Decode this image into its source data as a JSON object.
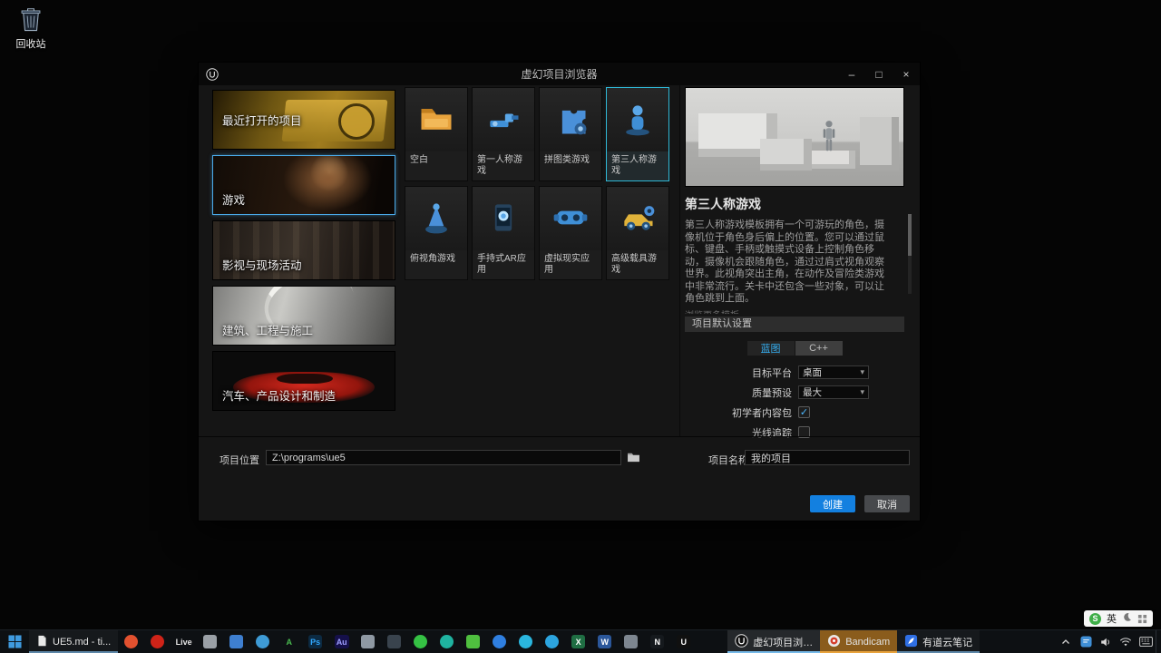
{
  "colors": {
    "accent_blue": "#35aef0",
    "selected_template_border": "#2fb8d6",
    "selected_category_border": "#4aa9e8",
    "create_button": "#1380e0",
    "bandicam_highlight": "#8a5c1c"
  },
  "desktop": {
    "recycle_bin_label": "回收站"
  },
  "window": {
    "title": "虚幻项目浏览器",
    "controls": {
      "minimize": "–",
      "maximize": "□",
      "close": "×"
    },
    "categories": [
      {
        "label": "最近打开的项目",
        "image": "recent-projects-thumb",
        "selected": false
      },
      {
        "label": "游戏",
        "image": "games-thumb",
        "selected": true
      },
      {
        "label": "影视与现场活动",
        "image": "film-live-events-thumb",
        "selected": false
      },
      {
        "label": "建筑、工程与施工",
        "image": "architecture-thumb",
        "selected": false
      },
      {
        "label": "汽车、产品设计和制造",
        "image": "automotive-thumb",
        "selected": false
      }
    ],
    "templates": [
      {
        "label": "空白",
        "icon": "blank-folder-icon",
        "selected": false
      },
      {
        "label": "第一人称游戏",
        "icon": "first-person-icon",
        "selected": false
      },
      {
        "label": "拼图类游戏",
        "icon": "puzzle-icon",
        "selected": false
      },
      {
        "label": "第三人称游戏",
        "icon": "third-person-icon",
        "selected": true
      },
      {
        "label": "俯视角游戏",
        "icon": "top-down-icon",
        "selected": false
      },
      {
        "label": "手持式AR应用",
        "icon": "handheld-ar-icon",
        "selected": false
      },
      {
        "label": "虚拟现实应用",
        "icon": "virtual-reality-icon",
        "selected": false
      },
      {
        "label": "高级载具游戏",
        "icon": "vehicle-icon",
        "selected": false
      }
    ],
    "detail": {
      "title": "第三人称游戏",
      "description": "第三人称游戏模板拥有一个可游玩的角色，摄像机位于角色身后偏上的位置。您可以通过鼠标、键盘、手柄或触摸式设备上控制角色移动，摄像机会跟随角色，通过过肩式视角观察世界。此视角突出主角，在动作及冒险类游戏中非常流行。关卡中还包含一些对象，可以让角色跳到上面。",
      "clipped_line": "浏览更多模板",
      "settings_header": "项目默认设置",
      "implementation": {
        "blueprint": "蓝图",
        "cpp": "C++"
      },
      "rows": {
        "target_platform_label": "目标平台",
        "target_platform_value": "桌面",
        "quality_label": "质量预设",
        "quality_value": "最大",
        "starter_content_label": "初学者内容包",
        "raytracing_label": "光线追踪"
      },
      "checkbox_checked_glyph": "✓",
      "dropdown_arrow": "▾"
    },
    "footer": {
      "location_label": "项目位置",
      "location_value": "Z:\\programs\\ue5",
      "name_label": "项目名称",
      "name_value": "我的项目",
      "create_label": "创建",
      "cancel_label": "取消"
    }
  },
  "taskbar": {
    "left_task_label": "UE5.md - ti...",
    "pinned": [
      {
        "name": "browser-icon",
        "shape": "circle",
        "bg": "#e2512f"
      },
      {
        "name": "red-circle-app-icon",
        "shape": "circle",
        "bg": "#cf2318"
      },
      {
        "name": "live-app-icon",
        "shape": "label",
        "bg": "transparent",
        "fg": "#e6e6e6",
        "glyph": "Live"
      },
      {
        "name": "camera-app-icon",
        "shape": "square",
        "bg": "#9aa0a6"
      },
      {
        "name": "blue-square-app-icon",
        "shape": "square",
        "bg": "#3e7fd0"
      },
      {
        "name": "blue-circle-app-icon",
        "shape": "circle",
        "bg": "#3e9bd6"
      },
      {
        "name": "green-a-app-icon",
        "shape": "label",
        "bg": "transparent",
        "fg": "#49b84f",
        "glyph": "A"
      },
      {
        "name": "photoshop-icon",
        "shape": "label",
        "bg": "#0c2a42",
        "fg": "#31a8ff",
        "glyph": "Ps"
      },
      {
        "name": "audition-icon",
        "shape": "label",
        "bg": "#15104a",
        "fg": "#9e9eff",
        "glyph": "Au"
      },
      {
        "name": "photos-app-icon",
        "shape": "square",
        "bg": "#8f99a3"
      },
      {
        "name": "dark-tool-app-icon",
        "shape": "square",
        "bg": "#39434d"
      },
      {
        "name": "wechat-icon",
        "shape": "circle",
        "bg": "#35c244"
      },
      {
        "name": "teal-circle-app-icon",
        "shape": "circle",
        "bg": "#1fb3a0"
      },
      {
        "name": "green-square-app-icon",
        "shape": "square",
        "bg": "#4fbf3f"
      },
      {
        "name": "blue-round-app-icon",
        "shape": "circle",
        "bg": "#2f7fe0"
      },
      {
        "name": "cyan-circle-app-icon",
        "shape": "circle",
        "bg": "#2ab6de"
      },
      {
        "name": "telegram-icon",
        "shape": "circle",
        "bg": "#2ca5e0"
      },
      {
        "name": "excel-icon",
        "shape": "label",
        "bg": "#1f6e43",
        "fg": "#ffffff",
        "glyph": "X"
      },
      {
        "name": "word-icon",
        "shape": "label",
        "bg": "#2b579a",
        "fg": "#ffffff",
        "glyph": "W"
      },
      {
        "name": "grey-window-app-icon",
        "shape": "square",
        "bg": "#7d8690"
      },
      {
        "name": "notion-icon",
        "shape": "label",
        "bg": "#15191d",
        "fg": "#ffffff",
        "glyph": "N"
      },
      {
        "name": "unreal-pinned-icon",
        "shape": "label",
        "bg": "#101010",
        "fg": "#ffffff",
        "glyph": "U"
      }
    ],
    "tasks": [
      {
        "name": "unreal-project-browser",
        "label": "虚幻项目浏览...",
        "state": "active"
      },
      {
        "name": "bandicam",
        "label": "Bandicam",
        "state": "highlight"
      },
      {
        "name": "youdao-note",
        "label": "有道云笔记",
        "state": "open"
      }
    ]
  },
  "ime_bar": {
    "logo_letter": "S",
    "lang": "英"
  }
}
